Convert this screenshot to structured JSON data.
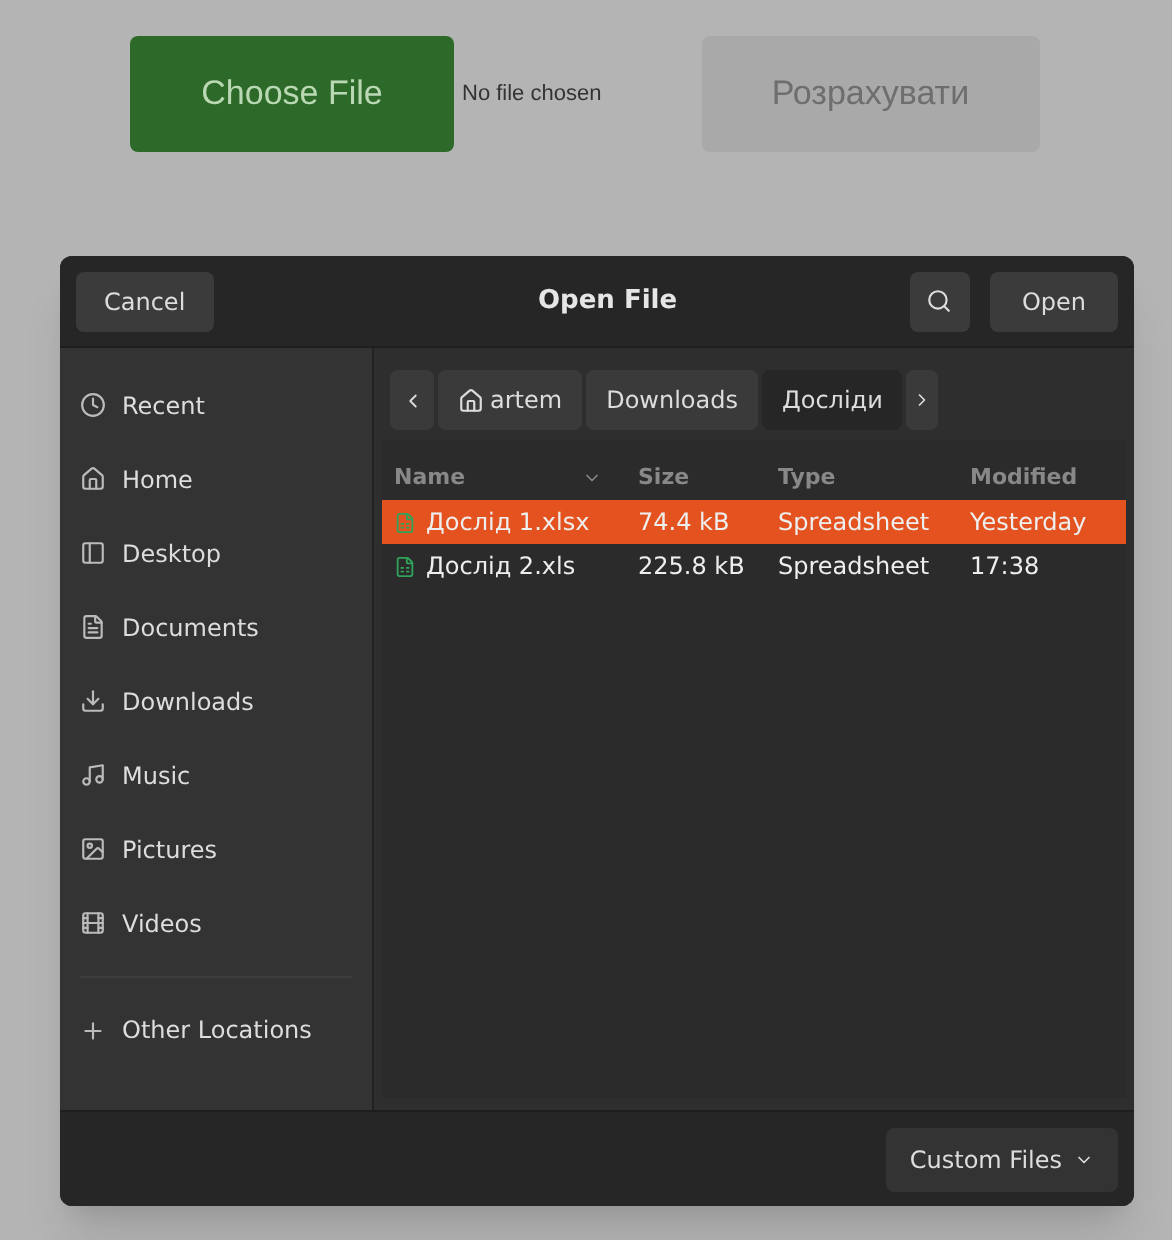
{
  "page": {
    "choose_button": "Choose File",
    "file_status": "No file chosen",
    "calculate_button": {
      "label": "Розрахувати",
      "disabled": true
    }
  },
  "dialog": {
    "title": "Open File",
    "cancel": "Cancel",
    "open": "Open",
    "sidebar": [
      {
        "kind": "recent",
        "label": "Recent"
      },
      {
        "kind": "home",
        "label": "Home"
      },
      {
        "kind": "desktop",
        "label": "Desktop"
      },
      {
        "kind": "documents",
        "label": "Documents"
      },
      {
        "kind": "downloads",
        "label": "Downloads"
      },
      {
        "kind": "music",
        "label": "Music"
      },
      {
        "kind": "pictures",
        "label": "Pictures"
      },
      {
        "kind": "videos",
        "label": "Videos"
      },
      {
        "kind": "other",
        "label": "Other Locations"
      }
    ],
    "path": [
      {
        "label": "artem",
        "home": true,
        "selected": false
      },
      {
        "label": "Downloads",
        "home": false,
        "selected": false
      },
      {
        "label": "Досліди",
        "home": false,
        "selected": true
      }
    ],
    "columns": [
      "Name",
      "Size",
      "Type",
      "Modified"
    ],
    "files": [
      {
        "name": "Дослід 1.xlsx",
        "size": "74.4 kB",
        "type": "Spreadsheet",
        "modified": "Yesterday",
        "selected": true
      },
      {
        "name": "Дослід 2.xls",
        "size": "225.8 kB",
        "type": "Spreadsheet",
        "modified": "17:38",
        "selected": false
      }
    ],
    "filter": "Custom Files"
  }
}
